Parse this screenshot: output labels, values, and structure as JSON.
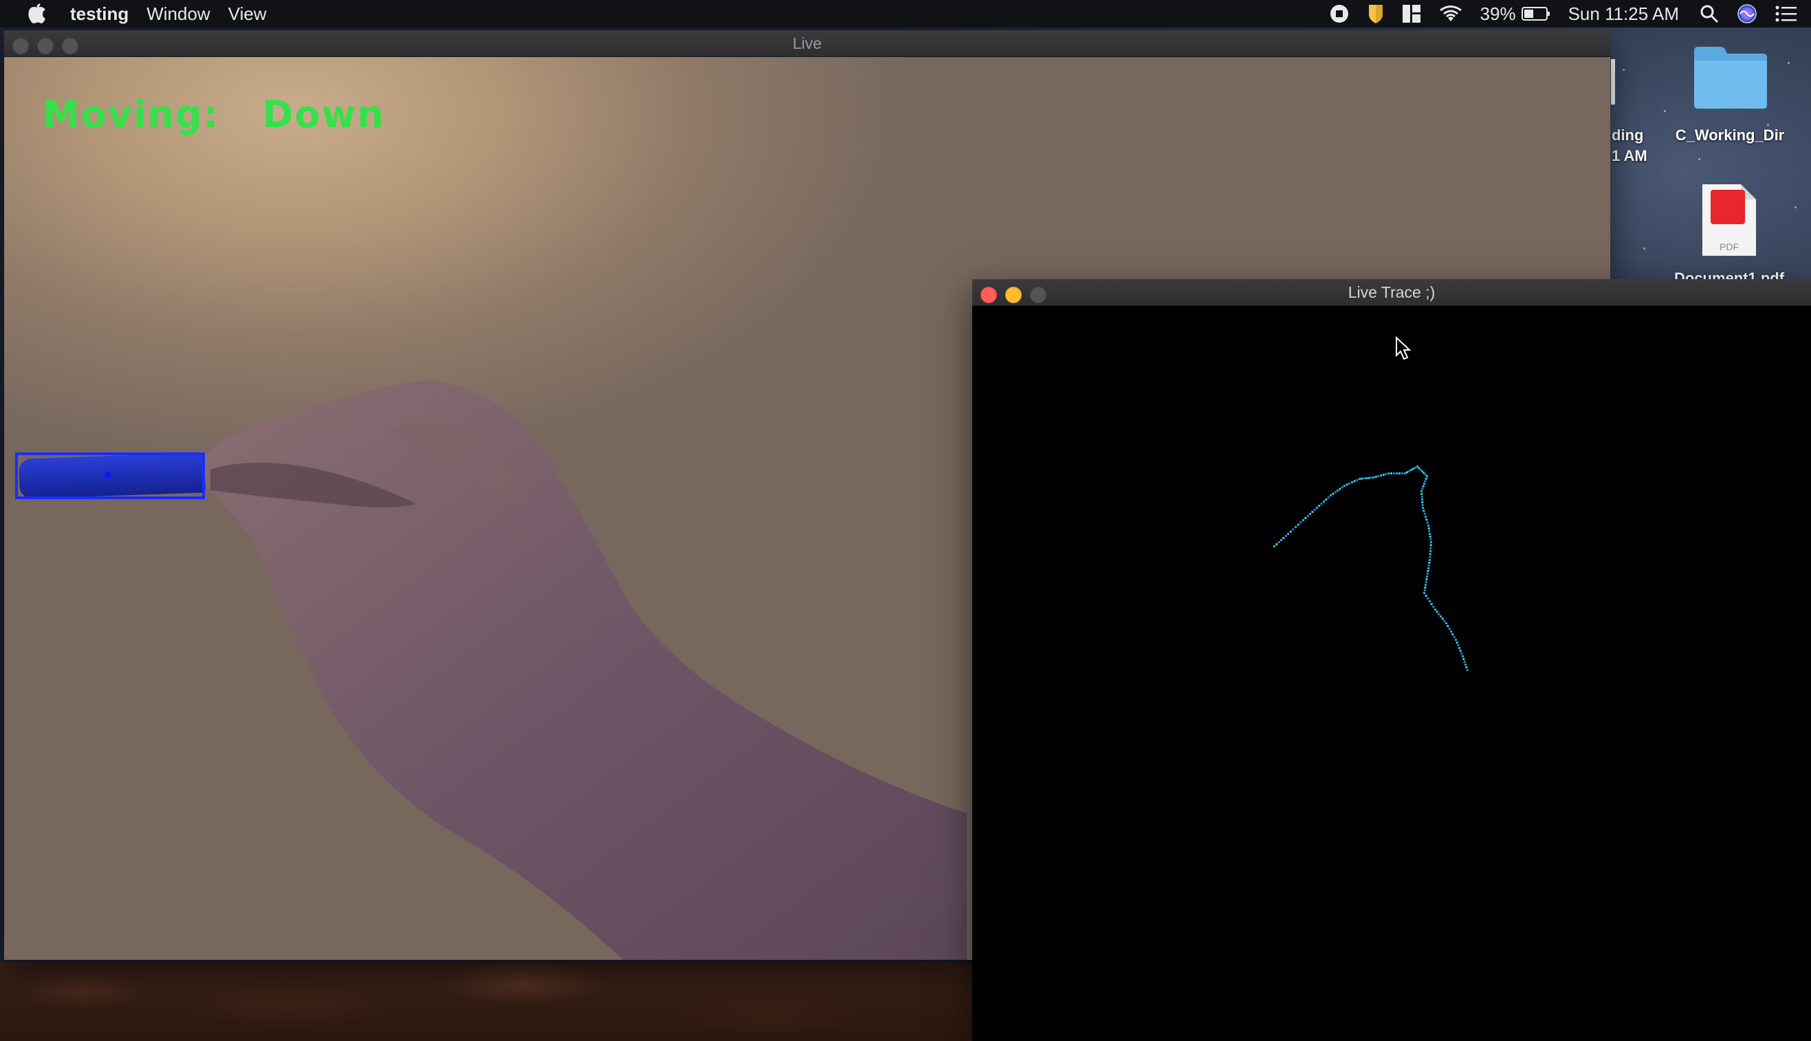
{
  "menubar": {
    "app_name": "testing",
    "menus": [
      "Window",
      "View"
    ],
    "battery_percent": "39%",
    "clock": "Sun 11:25 AM"
  },
  "desktop": {
    "icons": [
      {
        "label_line1": "ding",
        "label_line2": "1 AM",
        "icon": "partial-file-icon"
      },
      {
        "label": "C_Working_Dir",
        "icon": "folder-icon"
      },
      {
        "label": "Document1.pdf",
        "icon": "pdf-icon",
        "badge": "PDF"
      }
    ]
  },
  "live_window": {
    "title": "Live",
    "status_prefix": "Moving:",
    "status_direction": "Down",
    "status_color": "#35e04a",
    "tracker_color": "#1a2cff"
  },
  "trace_window": {
    "title": "Live Trace ;)",
    "trace_colors": [
      "#2aa9ff",
      "#3fe07a",
      "#1e7bff"
    ],
    "trace_points": [
      [
        0,
        0
      ],
      [
        20,
        -18
      ],
      [
        42,
        -38
      ],
      [
        62,
        -56
      ],
      [
        82,
        -74
      ],
      [
        102,
        -88
      ],
      [
        124,
        -98
      ],
      [
        144,
        -100
      ],
      [
        166,
        -106
      ],
      [
        190,
        -106
      ],
      [
        208,
        -116
      ],
      [
        222,
        -102
      ],
      [
        214,
        -80
      ],
      [
        216,
        -56
      ],
      [
        224,
        -30
      ],
      [
        228,
        -6
      ],
      [
        226,
        20
      ],
      [
        222,
        44
      ],
      [
        218,
        68
      ],
      [
        234,
        92
      ],
      [
        250,
        112
      ],
      [
        264,
        136
      ],
      [
        274,
        160
      ],
      [
        282,
        184
      ]
    ]
  }
}
